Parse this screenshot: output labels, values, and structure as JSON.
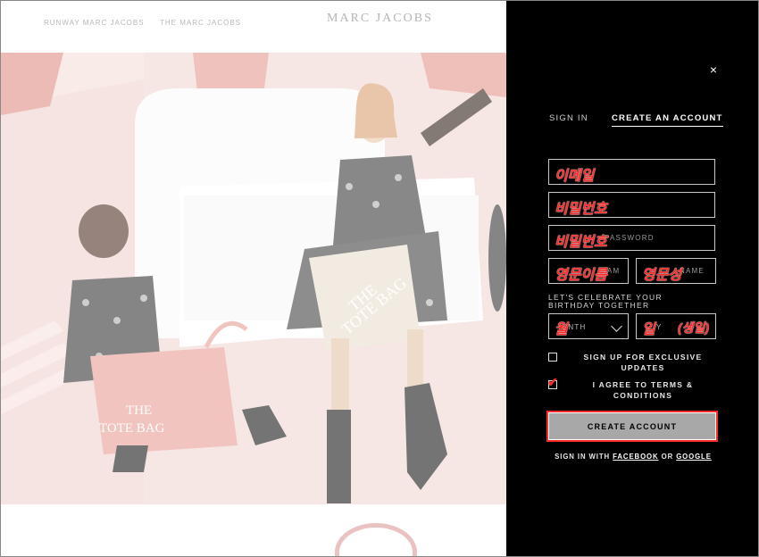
{
  "site": {
    "nav_left": [
      "RUNWAY MARC JACOBS",
      "THE MARC JACOBS"
    ],
    "logo": "MARC JACOBS"
  },
  "panel": {
    "close_icon": "×",
    "tabs": {
      "sign_in": "SIGN IN",
      "create_account": "CREATE AN ACCOUNT",
      "active": "create_account"
    },
    "fields": {
      "email": {
        "placeholder": "",
        "overlay": "이메일"
      },
      "password": {
        "placeholder": "",
        "overlay": "비밀번호"
      },
      "confirm_password": {
        "placeholder": "PASSWORD",
        "overlay": "비밀번호"
      },
      "first_name": {
        "placeholder": "NAME",
        "overlay": "영문이름"
      },
      "last_name": {
        "placeholder": "NAME",
        "overlay": "영문성"
      }
    },
    "birthday": {
      "label": "LET'S CELEBRATE YOUR BIRTHDAY TOGETHER",
      "month": {
        "value": "ONTH",
        "overlay": "월"
      },
      "day": {
        "value": "Y",
        "overlay": "일",
        "note": "(생일)"
      }
    },
    "checkboxes": {
      "exclusive_updates": {
        "label": "SIGN UP FOR EXCLUSIVE UPDATES",
        "checked": false
      },
      "terms": {
        "label": "I AGREE TO TERMS & CONDITIONS",
        "checked": true,
        "mark": "✔"
      }
    },
    "create_button": "CREATE ACCOUNT",
    "social": {
      "prefix": "SIGN IN WITH",
      "facebook": "FACEBOOK",
      "or": "OR",
      "google": "GOOGLE"
    }
  },
  "colors": {
    "panel_bg": "#000000",
    "accent_annotation": "#ff2a2a",
    "button_bg": "#a8a8a8"
  }
}
